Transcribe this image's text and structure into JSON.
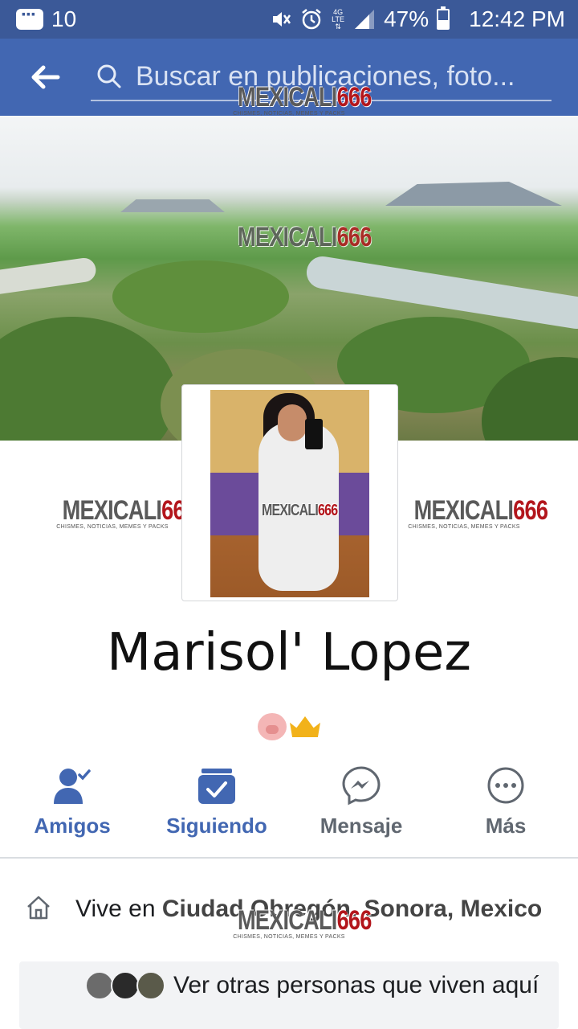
{
  "status_bar": {
    "notification_count": "10",
    "network": "4G LTE",
    "battery": "47%",
    "battery_level": 0.47,
    "time": "12:42 PM",
    "icons": [
      "messages-icon",
      "mute-icon",
      "alarm-icon",
      "signal-icon",
      "battery-icon"
    ]
  },
  "search": {
    "placeholder": "Buscar en publicaciones, foto..."
  },
  "watermark": {
    "logo_text": "MEXICALI",
    "logo_number": "666",
    "tagline": "CHISMES, NOTICIAS, MEMES Y PACKS"
  },
  "profile": {
    "name": "Marisol' Lopez"
  },
  "actions": {
    "friends": "Amigos",
    "following": "Siguiendo",
    "message": "Mensaje",
    "more": "Más"
  },
  "about": {
    "lives_prefix": "Vive en ",
    "location": "Ciudad Obregón, Sonora, Mexico",
    "others_link": "Ver otras personas que viven aquí"
  },
  "colors": {
    "status_bar": "#3b5998",
    "top_bar": "#4267b2",
    "accent": "#4267b2",
    "muted": "#606770"
  }
}
